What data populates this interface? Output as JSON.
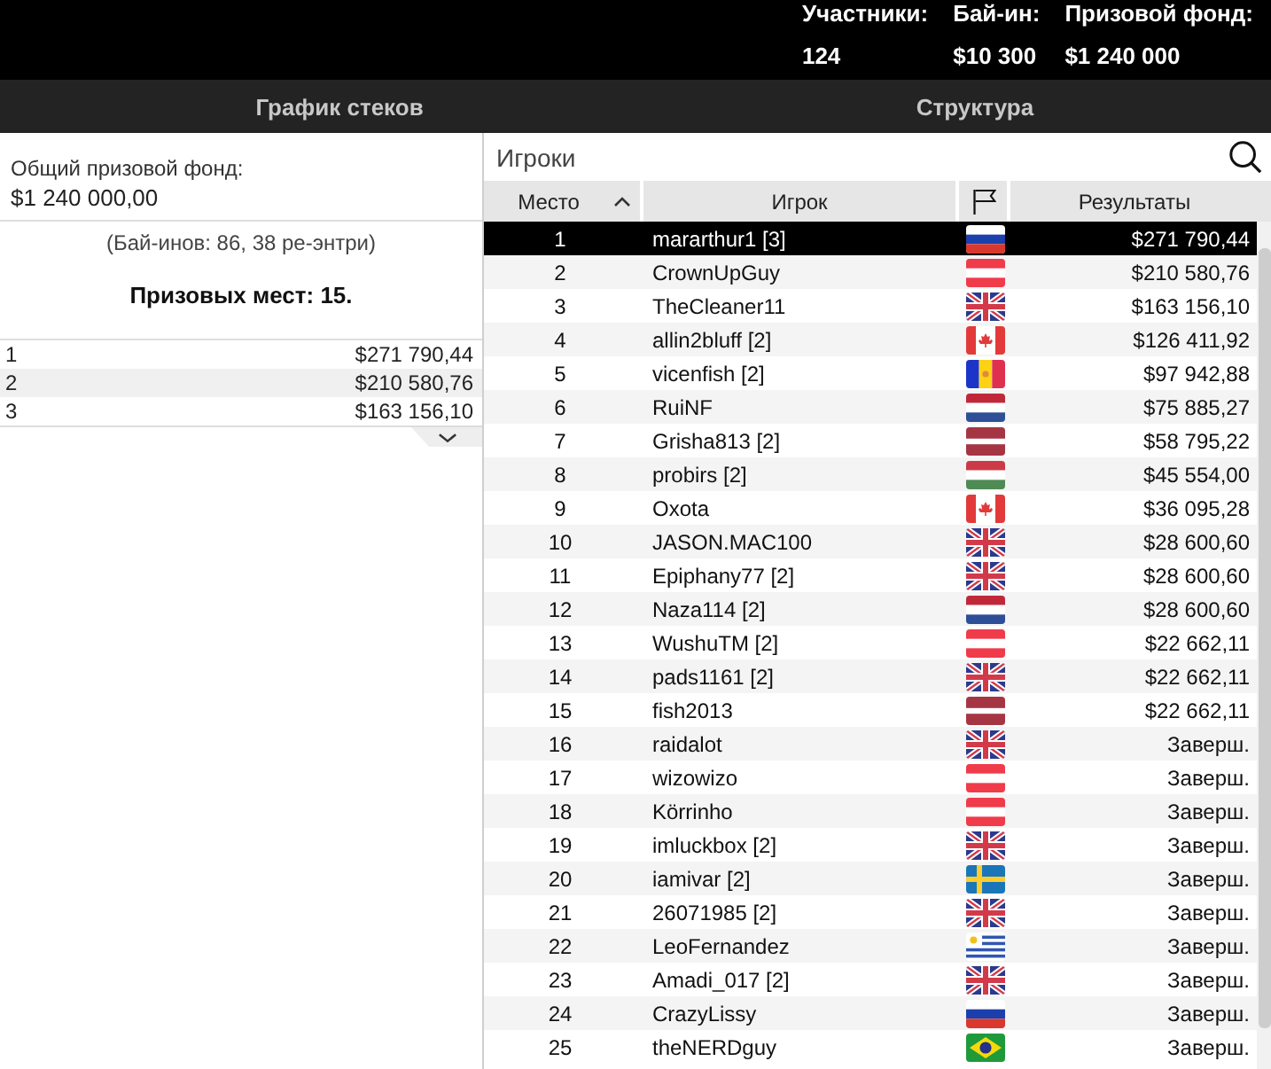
{
  "header": {
    "stats": [
      {
        "label": "Участники:",
        "value": "124"
      },
      {
        "label": "Бай-ин:",
        "value": "$10 300"
      },
      {
        "label": "Призовой фонд:",
        "value": "$1 240 000"
      }
    ]
  },
  "tabs": [
    {
      "label": "График стеков"
    },
    {
      "label": "Структура"
    }
  ],
  "prize_panel": {
    "total_label": "Общий призовой фонд:",
    "total": "$1 240 000,00",
    "entries_note": "(Бай-инов: 86, 38 ре-энтри)",
    "places_note": "Призовых мест: 15.",
    "payouts": [
      {
        "place": "1",
        "amount": "$271 790,44"
      },
      {
        "place": "2",
        "amount": "$210 580,76"
      },
      {
        "place": "3",
        "amount": "$163 156,10"
      }
    ]
  },
  "players": {
    "title": "Игроки",
    "columns": [
      {
        "kind": "text",
        "label": "Место",
        "sorted": true
      },
      {
        "kind": "text",
        "label": "Игрок",
        "sorted": false
      },
      {
        "kind": "flag",
        "sorted": false
      },
      {
        "kind": "text",
        "label": "Результаты",
        "sorted": false
      }
    ],
    "rows": [
      {
        "place": "1",
        "player": "mararthur1 [3]",
        "flag": {
          "kind": "ru"
        },
        "result": "$271 790,44",
        "selected": true
      },
      {
        "place": "2",
        "player": "CrownUpGuy",
        "flag": {
          "kind": "at"
        },
        "result": "$210 580,76",
        "selected": false
      },
      {
        "place": "3",
        "player": "TheCleaner11",
        "flag": {
          "kind": "gb"
        },
        "result": "$163 156,10",
        "selected": false
      },
      {
        "place": "4",
        "player": "allin2bluff [2]",
        "flag": {
          "kind": "ca"
        },
        "result": "$126 411,92",
        "selected": false
      },
      {
        "place": "5",
        "player": "vicenfish [2]",
        "flag": {
          "kind": "ad"
        },
        "result": "$97 942,88",
        "selected": false
      },
      {
        "place": "6",
        "player": "RuiNF",
        "flag": {
          "kind": "nl"
        },
        "result": "$75 885,27",
        "selected": false
      },
      {
        "place": "7",
        "player": "Grisha813 [2]",
        "flag": {
          "kind": "lv"
        },
        "result": "$58 795,22",
        "selected": false
      },
      {
        "place": "8",
        "player": "probirs [2]",
        "flag": {
          "kind": "hu"
        },
        "result": "$45 554,00",
        "selected": false
      },
      {
        "place": "9",
        "player": "Oxota",
        "flag": {
          "kind": "ca"
        },
        "result": "$36 095,28",
        "selected": false
      },
      {
        "place": "10",
        "player": "JASON.MAC100",
        "flag": {
          "kind": "gb"
        },
        "result": "$28 600,60",
        "selected": false
      },
      {
        "place": "11",
        "player": "Epiphany77 [2]",
        "flag": {
          "kind": "gb"
        },
        "result": "$28 600,60",
        "selected": false
      },
      {
        "place": "12",
        "player": "Naza114 [2]",
        "flag": {
          "kind": "nl"
        },
        "result": "$28 600,60",
        "selected": false
      },
      {
        "place": "13",
        "player": "WushuTM [2]",
        "flag": {
          "kind": "at"
        },
        "result": "$22 662,11",
        "selected": false
      },
      {
        "place": "14",
        "player": "pads1161 [2]",
        "flag": {
          "kind": "gb"
        },
        "result": "$22 662,11",
        "selected": false
      },
      {
        "place": "15",
        "player": "fish2013",
        "flag": {
          "kind": "lv"
        },
        "result": "$22 662,11",
        "selected": false
      },
      {
        "place": "16",
        "player": "raidalot",
        "flag": {
          "kind": "gb"
        },
        "result": "Заверш.",
        "selected": false
      },
      {
        "place": "17",
        "player": "wizowizo",
        "flag": {
          "kind": "at"
        },
        "result": "Заверш.",
        "selected": false
      },
      {
        "place": "18",
        "player": "Körrinho",
        "flag": {
          "kind": "at"
        },
        "result": "Заверш.",
        "selected": false
      },
      {
        "place": "19",
        "player": "imluckbox [2]",
        "flag": {
          "kind": "gb"
        },
        "result": "Заверш.",
        "selected": false
      },
      {
        "place": "20",
        "player": "iamivar [2]",
        "flag": {
          "kind": "se"
        },
        "result": "Заверш.",
        "selected": false
      },
      {
        "place": "21",
        "player": "26071985 [2]",
        "flag": {
          "kind": "gb"
        },
        "result": "Заверш.",
        "selected": false
      },
      {
        "place": "22",
        "player": "LeoFernandez",
        "flag": {
          "kind": "uy"
        },
        "result": "Заверш.",
        "selected": false
      },
      {
        "place": "23",
        "player": "Amadi_017 [2]",
        "flag": {
          "kind": "gb"
        },
        "result": "Заверш.",
        "selected": false
      },
      {
        "place": "24",
        "player": "CrazyLissy",
        "flag": {
          "kind": "ru"
        },
        "result": "Заверш.",
        "selected": false
      },
      {
        "place": "25",
        "player": "theNERDguy",
        "flag": {
          "kind": "br"
        },
        "result": "Заверш.",
        "selected": false
      }
    ]
  }
}
